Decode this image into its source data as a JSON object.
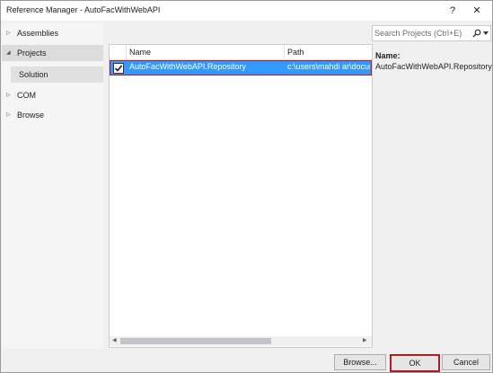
{
  "window": {
    "title": "Reference Manager - AutoFacWithWebAPI",
    "help_glyph": "?",
    "close_glyph": "✕"
  },
  "nav": {
    "items": [
      {
        "label": "Assemblies",
        "arrow": "▷"
      },
      {
        "label": "Projects",
        "arrow": "◢"
      },
      {
        "label": "COM",
        "arrow": "▷"
      },
      {
        "label": "Browse",
        "arrow": "▷"
      }
    ],
    "sub_items": [
      {
        "label": "Solution"
      }
    ]
  },
  "search": {
    "placeholder": "Search Projects (Ctrl+E)",
    "icon": "search-icon"
  },
  "grid": {
    "columns": [
      "Name",
      "Path"
    ],
    "rows": [
      {
        "checked": true,
        "name": "AutoFacWithWebAPI.Repository",
        "path": "c:\\users\\mahdi ar\\docum"
      }
    ]
  },
  "details": {
    "name_label": "Name:",
    "name_value": "AutoFacWithWebAPI.Repository"
  },
  "buttons": {
    "browse": "Browse...",
    "ok": "OK",
    "cancel": "Cancel"
  },
  "colors": {
    "selection": "#3399ff",
    "highlight_outline": "#b01a22"
  }
}
